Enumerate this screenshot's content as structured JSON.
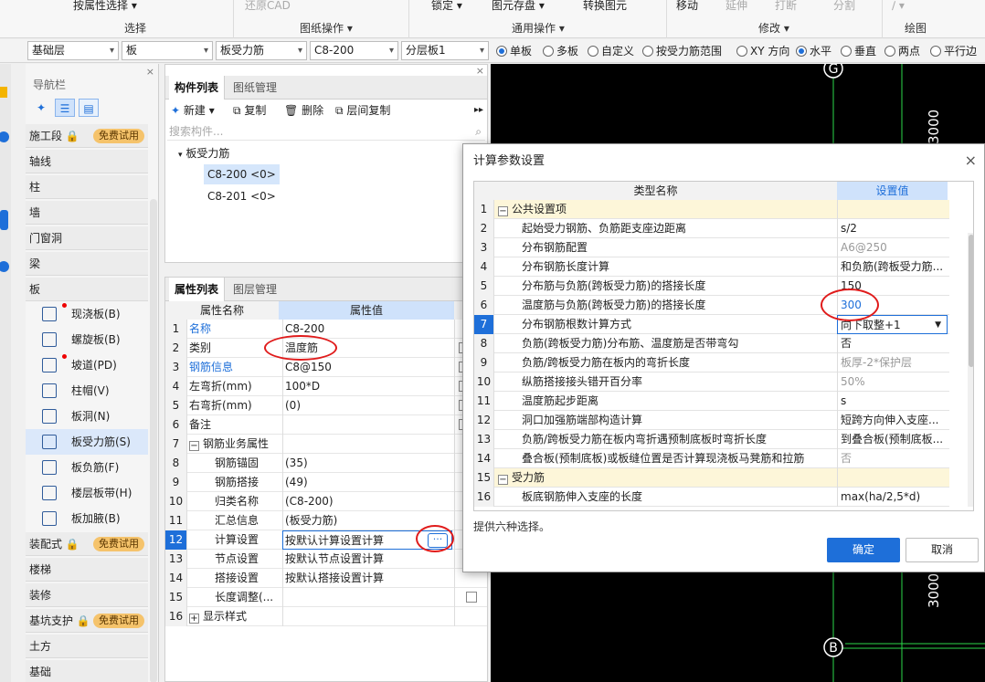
{
  "ribbon": {
    "items": [
      "按属性选择 ▾",
      "还原CAD",
      "锁定 ▾",
      "图元存盘 ▾",
      "转换图元",
      "移动",
      "延伸",
      "打断",
      "分割",
      "∕ ▾"
    ],
    "groups": [
      "选择",
      "图纸操作 ▾",
      "通用操作 ▾",
      "修改 ▾",
      "绘图"
    ]
  },
  "selector": {
    "floor": "基础层",
    "category": "板",
    "type": "板受力筋",
    "component": "C8-200",
    "layer": "分层板1",
    "radios": [
      {
        "label": "单板",
        "on": true
      },
      {
        "label": "多板",
        "on": false
      },
      {
        "label": "自定义",
        "on": false
      },
      {
        "label": "按受力筋范围",
        "on": false
      },
      {
        "label": "XY 方向",
        "on": false
      },
      {
        "label": "水平",
        "on": true
      },
      {
        "label": "垂直",
        "on": false
      },
      {
        "label": "两点",
        "on": false
      },
      {
        "label": "平行边",
        "on": false
      }
    ]
  },
  "nav": {
    "title": "导航栏",
    "close": "×",
    "trial_badge": "免费试用",
    "categories": [
      "施工段",
      "轴线",
      "柱",
      "墙",
      "门窗洞",
      "梁",
      "板",
      "装配式",
      "楼梯",
      "装修",
      "基坑支护",
      "土方",
      "基础"
    ],
    "sub_items": [
      "现浇板(B)",
      "螺旋板(B)",
      "坡道(PD)",
      "柱帽(V)",
      "板洞(N)",
      "板受力筋(S)",
      "板负筋(F)",
      "楼层板带(H)",
      "板加腋(B)"
    ]
  },
  "component_list": {
    "tabs": [
      "构件列表",
      "图纸管理"
    ],
    "toolbar": [
      "新建 ▾",
      "复制",
      "删除",
      "层间复制"
    ],
    "search_placeholder": "搜索构件...",
    "root": "板受力筋",
    "items": [
      "C8-200 <0>",
      "C8-201 <0>"
    ]
  },
  "properties": {
    "tabs": [
      "属性列表",
      "图层管理"
    ],
    "col_name": "属性名称",
    "col_value": "属性值",
    "col_attach": "附",
    "rows": [
      {
        "n": "1",
        "name": "名称",
        "value": "C8-200"
      },
      {
        "n": "2",
        "name": "类别",
        "value": "温度筋"
      },
      {
        "n": "3",
        "name": "钢筋信息",
        "value": "C8@150"
      },
      {
        "n": "4",
        "name": "左弯折(mm)",
        "value": "100*D"
      },
      {
        "n": "5",
        "name": "右弯折(mm)",
        "value": "(0)"
      },
      {
        "n": "6",
        "name": "备注",
        "value": ""
      },
      {
        "n": "7",
        "name": "钢筋业务属性",
        "value": ""
      },
      {
        "n": "8",
        "name": "钢筋锚固",
        "value": "(35)"
      },
      {
        "n": "9",
        "name": "钢筋搭接",
        "value": "(49)"
      },
      {
        "n": "10",
        "name": "归类名称",
        "value": "(C8-200)"
      },
      {
        "n": "11",
        "name": "汇总信息",
        "value": "(板受力筋)"
      },
      {
        "n": "12",
        "name": "计算设置",
        "value": "按默认计算设置计算"
      },
      {
        "n": "13",
        "name": "节点设置",
        "value": "按默认节点设置计算"
      },
      {
        "n": "14",
        "name": "搭接设置",
        "value": "按默认搭接设置计算"
      },
      {
        "n": "15",
        "name": "长度调整(...",
        "value": ""
      },
      {
        "n": "16",
        "name": "显示样式",
        "value": ""
      }
    ]
  },
  "canvas": {
    "axis_top": "G",
    "axis_bottom": "B",
    "dim_top": "3000",
    "dim_bottom": "3000"
  },
  "dialog": {
    "title": "计算参数设置",
    "close": "×",
    "col_type": "类型名称",
    "col_value": "设置值",
    "rows": [
      {
        "n": "1",
        "name": "公共设置项",
        "value": ""
      },
      {
        "n": "2",
        "name": "起始受力钢筋、负筋距支座边距离",
        "value": "s/2"
      },
      {
        "n": "3",
        "name": "分布钢筋配置",
        "value": "A6@250"
      },
      {
        "n": "4",
        "name": "分布钢筋长度计算",
        "value": "和负筋(跨板受力筋..."
      },
      {
        "n": "5",
        "name": "分布筋与负筋(跨板受力筋)的搭接长度",
        "value": "150"
      },
      {
        "n": "6",
        "name": "温度筋与负筋(跨板受力筋)的搭接长度",
        "value": "300"
      },
      {
        "n": "7",
        "name": "分布钢筋根数计算方式",
        "value": "向下取整+1"
      },
      {
        "n": "8",
        "name": "负筋(跨板受力筋)分布筋、温度筋是否带弯勾",
        "value": "否"
      },
      {
        "n": "9",
        "name": "负筋/跨板受力筋在板内的弯折长度",
        "value": "板厚-2*保护层"
      },
      {
        "n": "10",
        "name": "纵筋搭接接头错开百分率",
        "value": "50%"
      },
      {
        "n": "11",
        "name": "温度筋起步距离",
        "value": "s"
      },
      {
        "n": "12",
        "name": "洞口加强筋端部构造计算",
        "value": "短跨方向伸入支座..."
      },
      {
        "n": "13",
        "name": "负筋/跨板受力筋在板内弯折遇预制底板时弯折长度",
        "value": "到叠合板(预制底板..."
      },
      {
        "n": "14",
        "name": "叠合板(预制底板)或板缝位置是否计算现浇板马凳筋和拉筋",
        "value": "否"
      },
      {
        "n": "15",
        "name": "受力筋",
        "value": ""
      },
      {
        "n": "16",
        "name": "板底钢筋伸入支座的长度",
        "value": "max(ha/2,5*d)"
      }
    ],
    "hint": "提供六种选择。",
    "ok": "确定",
    "cancel": "取消"
  },
  "colors": {
    "accent": "#1e6fd9",
    "highlight": "#e01b1b",
    "canvas": "#000000",
    "axis": "#2bd94a"
  }
}
